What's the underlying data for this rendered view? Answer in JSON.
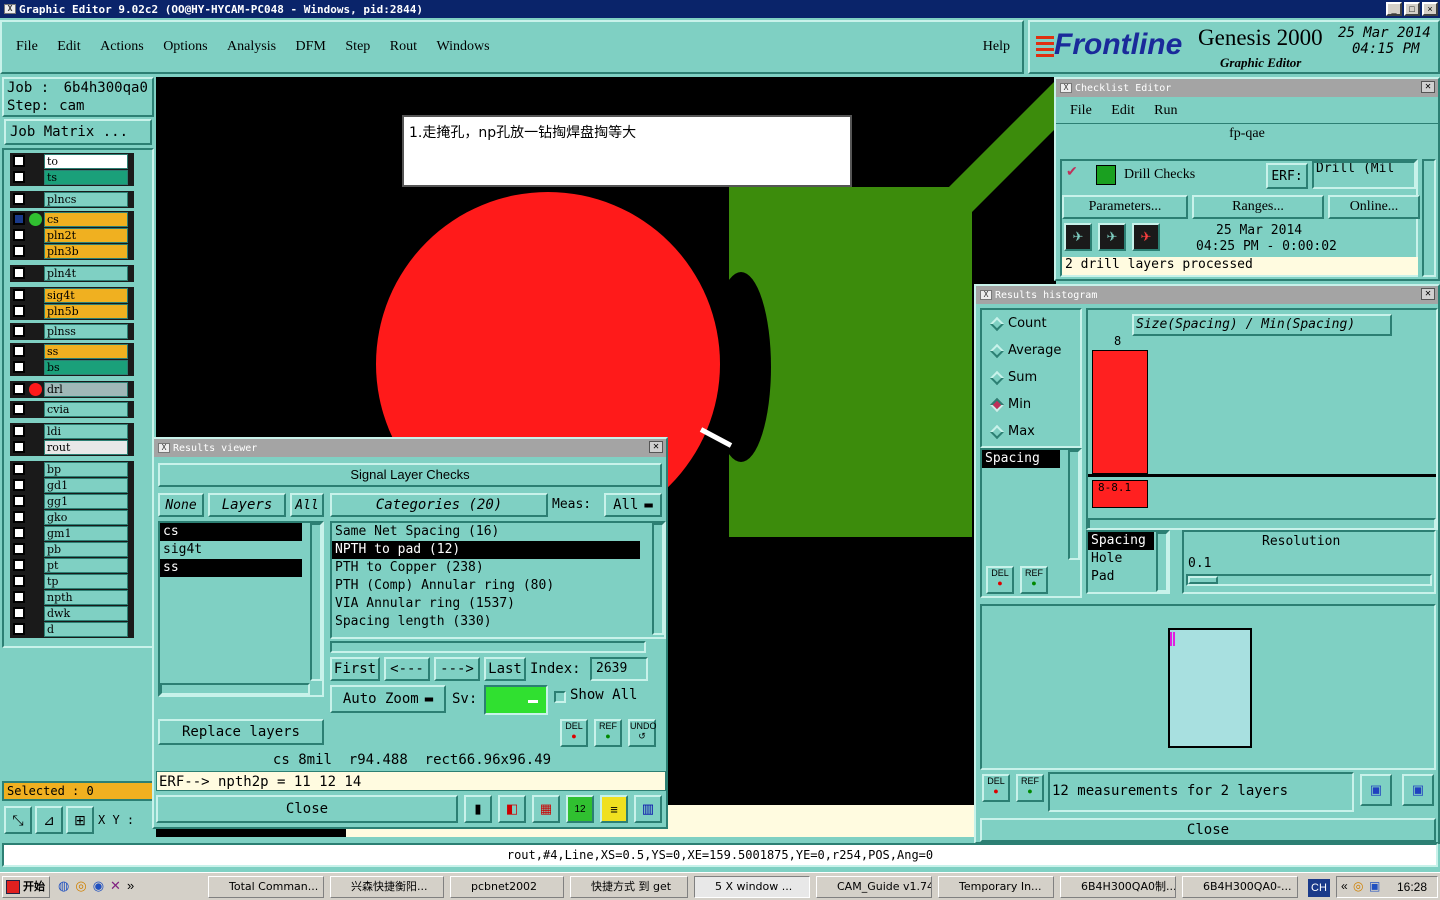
{
  "window": {
    "title": "Graphic Editor 9.02c2 (OO@HY-HYCAM-PC048 - Windows, pid:2844)"
  },
  "menu": [
    "File",
    "Edit",
    "Actions",
    "Options",
    "Analysis",
    "DFM",
    "Step",
    "Rout",
    "Windows"
  ],
  "help": "Help",
  "brand": {
    "logo": "Frontline",
    "product": "Genesis 2000",
    "subtitle": "Graphic Editor",
    "date": "25 Mar 2014",
    "time": "04:15 PM"
  },
  "job": {
    "job_label": "Job",
    "job_value": "6b4h300qa0",
    "step_label": "Step:",
    "step_value": "cam",
    "matrix_button": "Job Matrix ..."
  },
  "layers": [
    {
      "name": "to",
      "color": "#ffffff"
    },
    {
      "name": "ts",
      "color": "#1aa07a"
    },
    {
      "name": "plncs",
      "color": "#7fd0c3"
    },
    {
      "name": "cs",
      "color": "#f0b020"
    },
    {
      "name": "pln2t",
      "color": "#f0b020"
    },
    {
      "name": "pln3b",
      "color": "#f0b020"
    },
    {
      "name": "pln4t",
      "color": "#7fd0c3"
    },
    {
      "name": "sig4t",
      "color": "#f0b020"
    },
    {
      "name": "pln5b",
      "color": "#f0b020"
    },
    {
      "name": "plnss",
      "color": "#7fd0c3"
    },
    {
      "name": "ss",
      "color": "#f0b020"
    },
    {
      "name": "bs",
      "color": "#1aa07a"
    },
    {
      "name": "drl",
      "color": "#a0b8b8"
    },
    {
      "name": "cvia",
      "color": "#7fd0c3"
    },
    {
      "name": "ldi",
      "color": "#7fd0c3"
    },
    {
      "name": "rout",
      "color": "#e8e8e8"
    },
    {
      "name": "bp",
      "color": "#7fd0c3"
    },
    {
      "name": "gd1",
      "color": "#7fd0c3"
    },
    {
      "name": "gg1",
      "color": "#7fd0c3"
    },
    {
      "name": "gko",
      "color": "#7fd0c3"
    },
    {
      "name": "gm1",
      "color": "#7fd0c3"
    },
    {
      "name": "pb",
      "color": "#7fd0c3"
    },
    {
      "name": "pt",
      "color": "#7fd0c3"
    },
    {
      "name": "tp",
      "color": "#7fd0c3"
    },
    {
      "name": "npth",
      "color": "#7fd0c3"
    },
    {
      "name": "dwk",
      "color": "#7fd0c3"
    },
    {
      "name": "d",
      "color": "#7fd0c3"
    }
  ],
  "selected": "Selected : 0",
  "xy_label": "X Y :",
  "note": "1.走掩孔，np孔放一钻掏焊盘掏等大",
  "status_line": "rout,#4,Line,XS=0.5,YS=0,XE=159.5001875,YE=0,r254,POS,Ang=0",
  "checklist": {
    "title": "Checklist Editor",
    "menu": [
      "File",
      "Edit",
      "Run"
    ],
    "name": "fp-qae",
    "check": "Drill Checks",
    "erf_label": "ERF:",
    "erf_value": "Drill (Mil",
    "buttons": [
      "Parameters...",
      "Ranges...",
      "Online..."
    ],
    "date": "25 Mar 2014",
    "time": "04:25 PM - 0:00:02",
    "status": "2 drill layers processed"
  },
  "viewer": {
    "title": "Results viewer",
    "header": "Signal Layer Checks",
    "none": "None",
    "layers": "Layers",
    "all": "All",
    "layer_items": [
      "cs",
      "sig4t",
      "ss"
    ],
    "categories": "Categories (20)",
    "meas_label": "Meas:",
    "meas_value": "All",
    "category_items": [
      "Same Net Spacing (16)",
      "NPTH to pad (12)",
      "PTH to Copper (238)",
      "PTH (Comp) Annular ring (80)",
      "VIA Annular ring (1537)",
      "Spacing length (330)"
    ],
    "first": "First",
    "prev": "<---",
    "next": "--->",
    "last": "Last",
    "index_label": "Index:",
    "index_value": "2639",
    "auto_zoom": "Auto Zoom",
    "sv_label": "Sv:",
    "show_all": "Show All",
    "replace": "Replace layers",
    "info": "cs 8mil  r94.488  rect66.96x96.49",
    "erf": "ERF--> npth2p = 11 12 14",
    "close": "Close",
    "del": "DEL",
    "ref": "REF",
    "undo": "UNDO"
  },
  "histogram": {
    "title": "Results histogram",
    "options": [
      "Count",
      "Average",
      "Sum",
      "Min",
      "Max"
    ],
    "selected_option": "Min",
    "measure": "Spacing",
    "axis_title": "Size(Spacing) / Min(Spacing)",
    "bar_value": "8",
    "bar_range": "8-8.1",
    "list": [
      "Spacing",
      "Hole",
      "Pad"
    ],
    "resolution_label": "Resolution",
    "resolution_value": "0.1",
    "summary": "12 measurements for 2 layers",
    "close": "Close",
    "del": "DEL",
    "ref": "REF"
  },
  "taskbar": {
    "start": "开始",
    "items": [
      "Total Comman...",
      "兴森快捷衡阳...",
      "pcbnet2002",
      "快捷方式 到 get",
      "5 X window ...",
      "CAM_Guide v1.74",
      "Temporary In...",
      "6B4H300QA0制...",
      "6B4H300QA0-..."
    ],
    "lang": "CH",
    "clock": "16:28"
  },
  "colors": {
    "bg": "#7fd0c3",
    "red": "#ff1a1a",
    "green": "#3c8c0c"
  }
}
